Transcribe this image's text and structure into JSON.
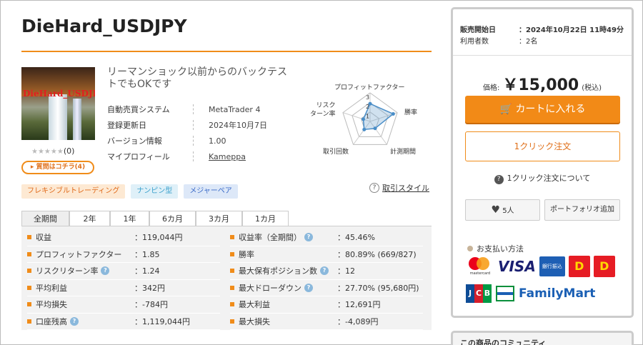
{
  "product": {
    "title": "DieHard_USDJPY",
    "thumbnail_text": "DieHard_USDJPY",
    "stars": "★★★★★",
    "review_count": "(0)",
    "question_button": "▸ 質問はコチラ(4)",
    "catchcopy": "リーマンショック以前からのバックテストでもOKです"
  },
  "info": [
    {
      "label": "自動売買システム",
      "value": "MetaTrader 4"
    },
    {
      "label": "登録更新日",
      "value": "2024年10月7日"
    },
    {
      "label": "バージョン情報",
      "value": "1.00"
    },
    {
      "label": "マイプロフィール",
      "value": "Kameppa"
    }
  ],
  "radar": {
    "labels": {
      "top": "プロフィットファクター",
      "right_top": "勝率",
      "right_bottom": "計測期間",
      "left_bottom": "取引回数",
      "left_top": "リスク\nターン率"
    },
    "scale_labels": [
      "3",
      "2",
      "1"
    ],
    "values": [
      0.62,
      0.85,
      0.3,
      0.35,
      0.25
    ]
  },
  "tags": [
    "フレキシブルトレーディング",
    "ナンピン型",
    "メジャーペア"
  ],
  "trade_style_link": "取引スタイル",
  "tabs": [
    "全期間",
    "2年",
    "1年",
    "6カ月",
    "3カ月",
    "1カ月"
  ],
  "stats_left": [
    {
      "label": "収益",
      "value": "：119,044円",
      "hint": false
    },
    {
      "label": "プロフィットファクター",
      "value": "：1.85",
      "hint": false
    },
    {
      "label": "リスクリターン率",
      "value": "：1.24",
      "hint": true
    },
    {
      "label": "平均利益",
      "value": "：342円",
      "hint": false
    },
    {
      "label": "平均損失",
      "value": "：-784円",
      "hint": false
    },
    {
      "label": "口座残高",
      "value": "：1,119,044円",
      "hint": true
    }
  ],
  "stats_right": [
    {
      "label": "収益率（全期間）",
      "value": "：45.46%",
      "hint": true
    },
    {
      "label": "勝率",
      "value": "：80.89% (669/827)",
      "hint": false
    },
    {
      "label": "最大保有ポジション数",
      "value": "：12",
      "hint": true
    },
    {
      "label": "最大ドローダウン",
      "value": "：27.70% (95,680円)",
      "hint": true
    },
    {
      "label": "最大利益",
      "value": "：12,691円",
      "hint": false
    },
    {
      "label": "最大損失",
      "value": "：-4,089円",
      "hint": false
    }
  ],
  "sidebar": {
    "sale_start_label": "販売開始日",
    "sale_start_value": "：2024年10月22日 11時49分",
    "users_label": "利用者数",
    "users_value": "：2名",
    "price_label": "価格:",
    "price_value": "￥15,000",
    "price_tax": "(税込)",
    "cart_button": "カートに入れる",
    "oneclick_button": "1クリック注文",
    "oneclick_about": "1クリック注文について",
    "likes": "5人",
    "portfolio_button": "ポートフォリオ追加",
    "payment_title": "お支払い方法",
    "payment_logos": {
      "mastercard": "mastercard",
      "visa": "VISA",
      "bank": "銀行振込",
      "jcb": "JCB",
      "familymart": "FamilyMart"
    },
    "community_title": "この商品のコミュニティ"
  },
  "colors": {
    "accent": "#f08c1a",
    "tag_orange": "#e06a1a",
    "tag_cyan": "#3aa0cc",
    "tag_blue": "#3a6ac8"
  }
}
